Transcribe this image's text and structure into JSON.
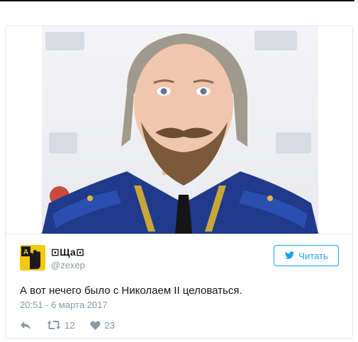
{
  "tweet": {
    "display_name": "⊡Щa⊡",
    "username": "@zexep",
    "follow_label": "Читать",
    "text": "А вот нечего было с Николаем II целоваться.",
    "timestamp": "20:51 - 6 марта 2017",
    "retweets": "12",
    "likes": "23"
  },
  "icons": {
    "reply": "reply-icon",
    "retweet": "retweet-icon",
    "like": "heart-icon",
    "follow": "twitter-bird-icon",
    "avatar": "hand-stop-icon"
  },
  "colors": {
    "accent": "#1da1f2",
    "muted": "#8899a6",
    "text": "#14171a",
    "avatar_bg": "#f6c90e"
  }
}
